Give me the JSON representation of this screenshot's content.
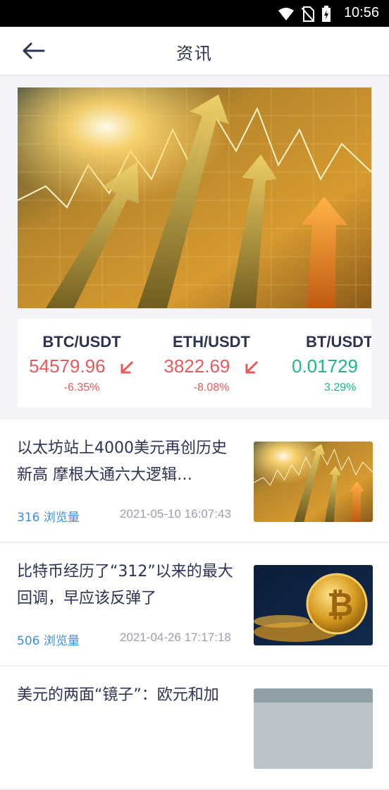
{
  "status_bar": {
    "time": "10:56"
  },
  "header": {
    "title": "资讯"
  },
  "ticker": [
    {
      "pair": "BTC/USDT",
      "price": "54579.96",
      "change": "-6.35%",
      "direction": "down"
    },
    {
      "pair": "ETH/USDT",
      "price": "3822.69",
      "change": "-8.08%",
      "direction": "down"
    },
    {
      "pair": "BT/USDT",
      "price": "0.01729",
      "change": "3.29%",
      "direction": "up"
    }
  ],
  "news": [
    {
      "title": "以太坊站上4000美元再创历史新高 摩根大通六大逻辑…",
      "views": "316 浏览量",
      "date": "2021-05-10 16:07:43",
      "thumb": "chart-arrows"
    },
    {
      "title": "比特币经历了“312”以来的最大回调，早应该反弹了",
      "views": "506 浏览量",
      "date": "2021-04-26 17:17:18",
      "thumb": "bitcoin-coin"
    },
    {
      "title": "美元的两面“镜子”：欧元和加",
      "views": "",
      "date": "",
      "thumb": "banknotes"
    }
  ],
  "colors": {
    "down": "#e85a5a",
    "up": "#19b98a",
    "accent": "#3b8fd9",
    "title": "#2c3354"
  }
}
